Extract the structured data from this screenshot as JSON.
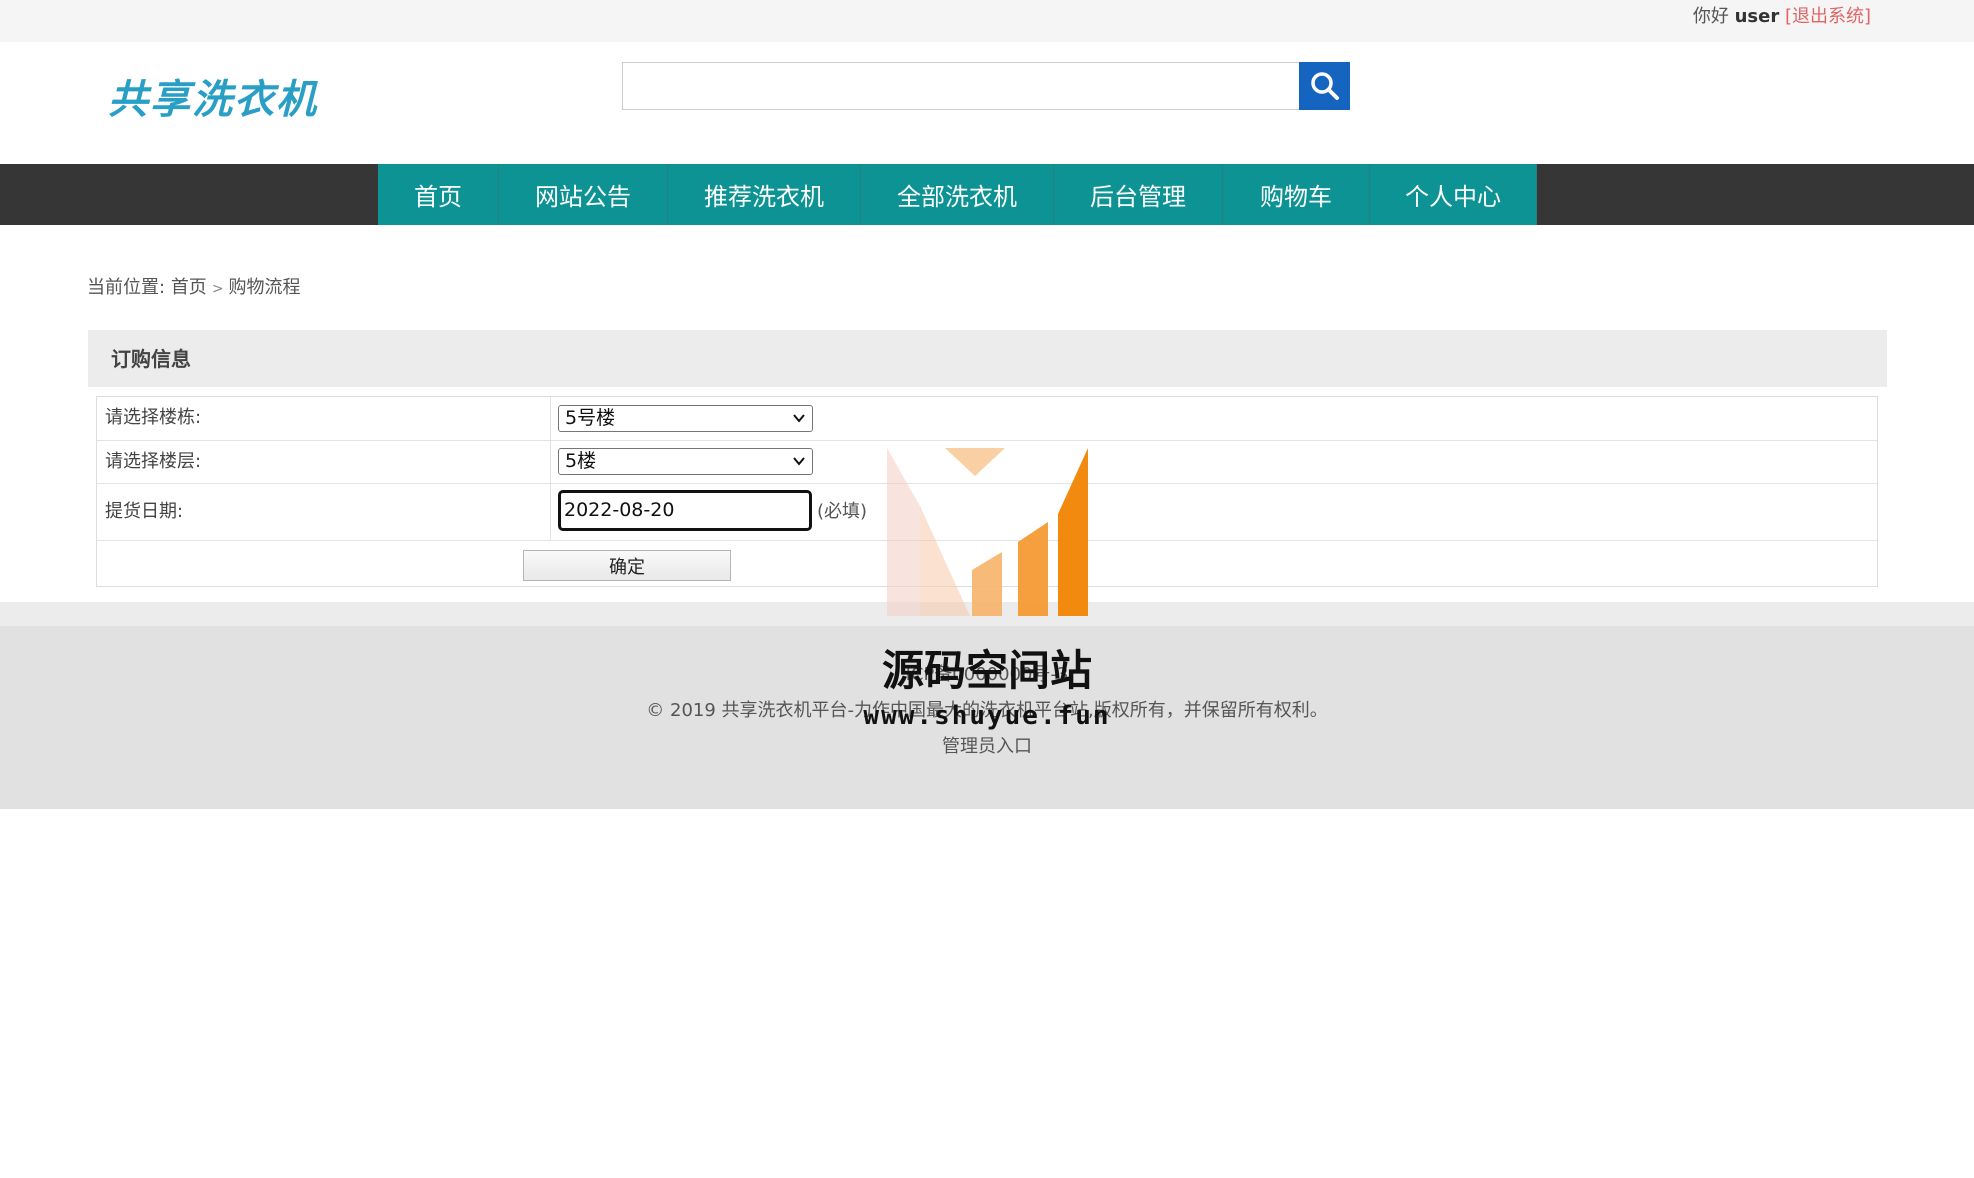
{
  "topbar": {
    "greeting": "你好",
    "username": "user",
    "logout_label": "[退出系统]"
  },
  "header": {
    "logo_text": "共享洗衣机",
    "search": {
      "placeholder": "",
      "value": ""
    },
    "search_icon": "search-icon"
  },
  "nav": {
    "items": [
      {
        "label": "首页"
      },
      {
        "label": "网站公告"
      },
      {
        "label": "推荐洗衣机"
      },
      {
        "label": "全部洗衣机"
      },
      {
        "label": "后台管理"
      },
      {
        "label": "购物车"
      },
      {
        "label": "个人中心"
      }
    ]
  },
  "breadcrumb": {
    "prefix": "当前位置:",
    "home": "首页",
    "separator": ">",
    "current": "购物流程"
  },
  "order": {
    "section_title": "订购信息",
    "building_label": "请选择楼栋:",
    "building_value": "5号楼",
    "floor_label": "请选择楼层:",
    "floor_value": "5楼",
    "date_label": "提货日期:",
    "date_value": "2022-08-20",
    "required_note": "(必填)",
    "confirm_label": "确定"
  },
  "footer": {
    "icp": "ICP备0000000号-3",
    "copyright": "© 2019 共享洗衣机平台-力作中国最大的洗衣机平台站,版权所有，并保留所有权利。",
    "admin_link": "管理员入口"
  },
  "watermark": {
    "title": "源码空间站",
    "url": "www.shuyue.fun"
  },
  "colors": {
    "nav_bg": "#363636",
    "nav_active_bg": "#0d9394",
    "search_btn": "#1565c0",
    "logout": "#e06666",
    "logo": "#2a9fc5"
  }
}
